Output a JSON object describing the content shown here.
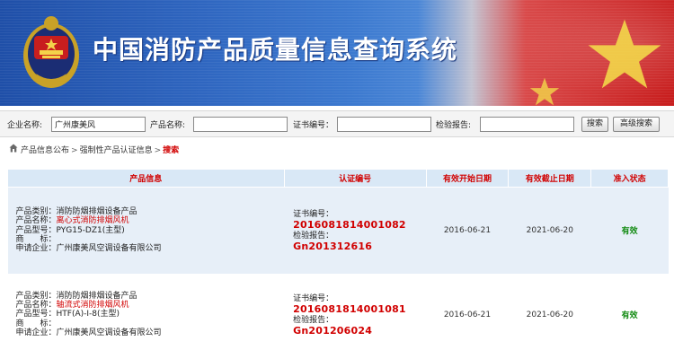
{
  "banner": {
    "title": "中国消防产品质量信息查询系统",
    "emblem": "police-emblem-icon"
  },
  "search": {
    "fields": [
      {
        "label": "企业名称:",
        "value": "广州康美风",
        "placeholder": ""
      },
      {
        "label": "产品名称:",
        "value": "",
        "placeholder": ""
      },
      {
        "label": "证书编号：",
        "value": "",
        "placeholder": ""
      },
      {
        "label": "检验报告:",
        "value": "",
        "placeholder": ""
      }
    ],
    "search_button": "搜索",
    "advanced_button": "高级搜索"
  },
  "breadcrumb": {
    "home_icon": "home-icon",
    "items": [
      "产品信息公布",
      "强制性产品认证信息"
    ],
    "current": "搜索",
    "separator": ">"
  },
  "table": {
    "columns": [
      "产品信息",
      "认证编号",
      "有效开始日期",
      "有效截止日期",
      "准入状态"
    ],
    "rows": [
      {
        "category_label": "产品类别：",
        "category": "消防防烟排烟设备产品",
        "name_label": "产品名称：",
        "name": "离心式消防排烟风机",
        "model_label": "产品型号：",
        "model": "PYG15-DZ1(主型)",
        "brand_label": "商　　标：",
        "brand": "",
        "company_label": "申请企业：",
        "company": "广州康美风空调设备有限公司",
        "cert_label": "证书编号：",
        "cert_no": "2016081814001082",
        "report_label": "检验报告：",
        "report_no": "Gn201312616",
        "start_date": "2016-06-21",
        "end_date": "2021-06-20",
        "status": "有效"
      },
      {
        "category_label": "产品类别：",
        "category": "消防防烟排烟设备产品",
        "name_label": "产品名称：",
        "name": "轴流式消防排烟风机",
        "model_label": "产品型号：",
        "model": "HTF(A)-I-8(主型)",
        "brand_label": "商　　标：",
        "brand": "",
        "company_label": "申请企业：",
        "company": "广州康美风空调设备有限公司",
        "cert_label": "证书编号：",
        "cert_no": "2016081814001081",
        "report_label": "检验报告：",
        "report_no": "Gn201206024",
        "start_date": "2016-06-21",
        "end_date": "2021-06-20",
        "status": "有效"
      }
    ]
  },
  "colors": {
    "banner_blue": "#2f66c0",
    "flag_red": "#c81e1e",
    "header_bg": "#d9e8f6",
    "row_alt_bg": "#e7eff8",
    "accent_red": "#d10000",
    "status_green": "#118a11"
  }
}
